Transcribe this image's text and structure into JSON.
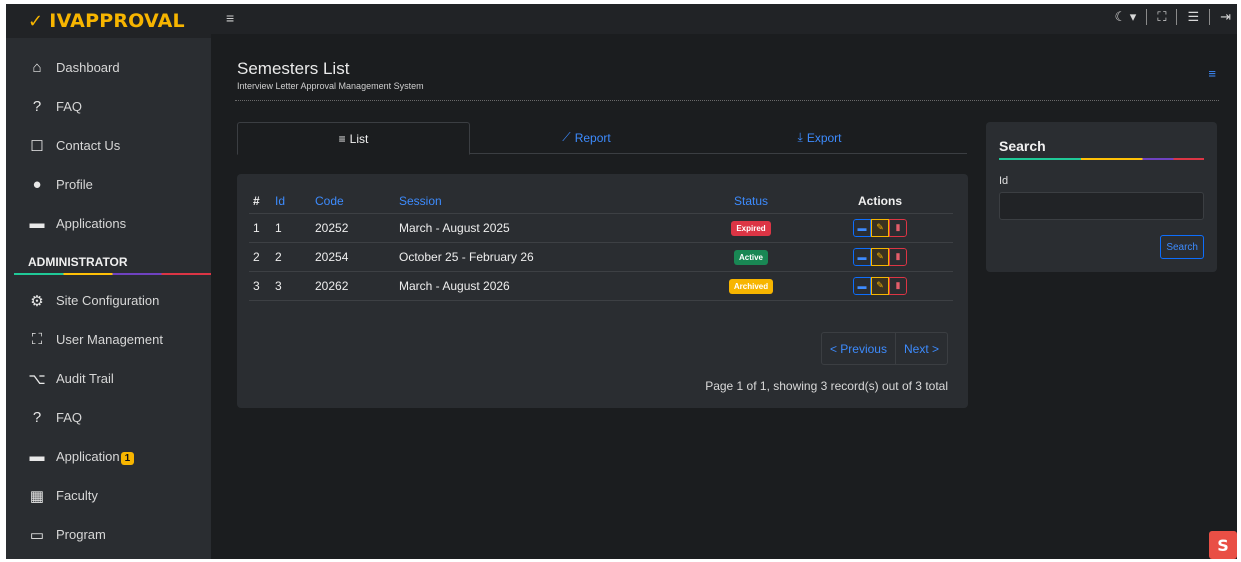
{
  "brand": {
    "check": "✓",
    "name": "IVAPPROVAL"
  },
  "sidebar": {
    "items": [
      {
        "icon": "home-icon",
        "glyph": "⌂",
        "label": "Dashboard"
      },
      {
        "icon": "help-icon",
        "glyph": "?",
        "label": "FAQ"
      },
      {
        "icon": "chat-icon",
        "glyph": "☐",
        "label": "Contact Us"
      },
      {
        "icon": "user-icon",
        "glyph": "●",
        "label": "Profile"
      },
      {
        "icon": "folder-icon",
        "glyph": "▬",
        "label": "Applications"
      }
    ],
    "section_title": "ADMINISTRATOR",
    "admin_items": [
      {
        "icon": "gear-icon",
        "glyph": "⚙",
        "label": "Site Configuration"
      },
      {
        "icon": "users-icon",
        "glyph": "⛶",
        "label": "User Management"
      },
      {
        "icon": "sitemap-icon",
        "glyph": "⌥",
        "label": "Audit Trail"
      },
      {
        "icon": "help-icon",
        "glyph": "?",
        "label": "FAQ"
      },
      {
        "icon": "folder-icon",
        "glyph": "▬",
        "label": "Application",
        "badge": "1"
      },
      {
        "icon": "building-icon",
        "glyph": "▦",
        "label": "Faculty"
      },
      {
        "icon": "laptop-icon",
        "glyph": "▭",
        "label": "Program"
      }
    ]
  },
  "topbar": {
    "menu_glyph": "≡",
    "theme_glyph": "☾ ▾",
    "fullscreen_glyph": "⛶",
    "panel_glyph": "☰",
    "logout_glyph": "⇥"
  },
  "page": {
    "title": "Semesters List",
    "subtitle": "Interview Letter Approval Management System",
    "menu_glyph": "≡"
  },
  "tabs": [
    {
      "icon": "≡",
      "label": "List"
    },
    {
      "icon": "⟋",
      "label": "Report"
    },
    {
      "icon": "⤓",
      "label": "Export"
    }
  ],
  "table": {
    "headers": {
      "num": "#",
      "id": "Id",
      "code": "Code",
      "session": "Session",
      "status": "Status",
      "actions": "Actions"
    },
    "rows": [
      {
        "num": "1",
        "id": "1",
        "code": "20252",
        "session": "March - August 2025",
        "status": "Expired",
        "status_color": "#dc3545",
        "status_text_color": "#ffffff"
      },
      {
        "num": "2",
        "id": "2",
        "code": "20254",
        "session": "October 25 - February 26",
        "status": "Active",
        "status_color": "#198754",
        "status_text_color": "#ffffff"
      },
      {
        "num": "3",
        "id": "3",
        "code": "20262",
        "session": "March - August 2026",
        "status": "Archived",
        "status_color": "#f7b500",
        "status_text_color": "#ffffff"
      }
    ],
    "action_glyphs": {
      "view": "▬",
      "edit": "✎",
      "delete": "▮"
    }
  },
  "pagination": {
    "previous": "< Previous",
    "next": "Next >",
    "info": "Page 1 of 1, showing 3 record(s) out of 3 total"
  },
  "search": {
    "title": "Search",
    "field_label": "Id",
    "field_value": "",
    "button": "Search"
  },
  "corner_logo": "S"
}
